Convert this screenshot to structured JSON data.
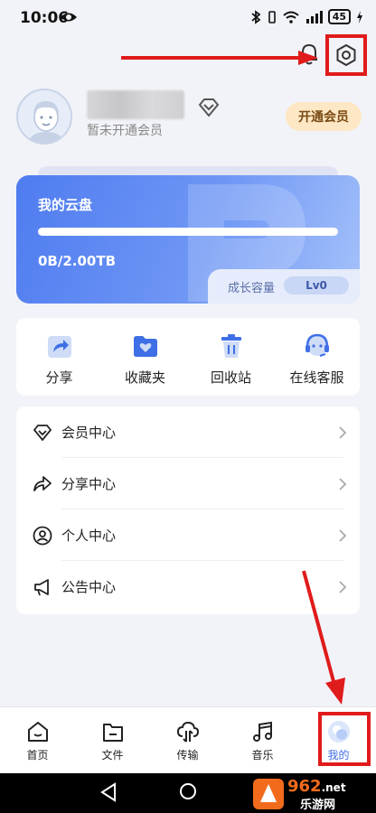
{
  "status_bar": {
    "time": "10:06",
    "battery": "45"
  },
  "profile": {
    "member_status": "暂未开通会员",
    "open_vip_label": "开通会员"
  },
  "cloud_card": {
    "title": "我的云盘",
    "capacity": "0B/2.00TB",
    "used_fraction": 0,
    "growth_label": "成长容量",
    "level": "Lv0"
  },
  "quick_actions": [
    {
      "label": "分享",
      "icon": "share-icon"
    },
    {
      "label": "收藏夹",
      "icon": "favorites-folder-icon"
    },
    {
      "label": "回收站",
      "icon": "recycle-bin-icon"
    },
    {
      "label": "在线客服",
      "icon": "customer-service-icon"
    }
  ],
  "menu": [
    {
      "label": "会员中心",
      "icon": "diamond-icon"
    },
    {
      "label": "分享中心",
      "icon": "share-arrow-icon"
    },
    {
      "label": "个人中心",
      "icon": "person-icon"
    },
    {
      "label": "公告中心",
      "icon": "megaphone-icon"
    }
  ],
  "bottom_nav": [
    {
      "label": "首页",
      "icon": "home-icon"
    },
    {
      "label": "文件",
      "icon": "folder-icon"
    },
    {
      "label": "传输",
      "icon": "transfer-icon"
    },
    {
      "label": "音乐",
      "icon": "music-icon"
    },
    {
      "label": "我的",
      "icon": "profile-icon",
      "active": true
    }
  ],
  "watermark": {
    "brand": "962",
    "suffix": ".net",
    "tagline": "乐游网"
  },
  "colors": {
    "accent": "#4f7cf0",
    "annotation_red": "#e01b1b",
    "vip_bg": "#fde7c4",
    "page_bg": "#f2f3f8"
  }
}
